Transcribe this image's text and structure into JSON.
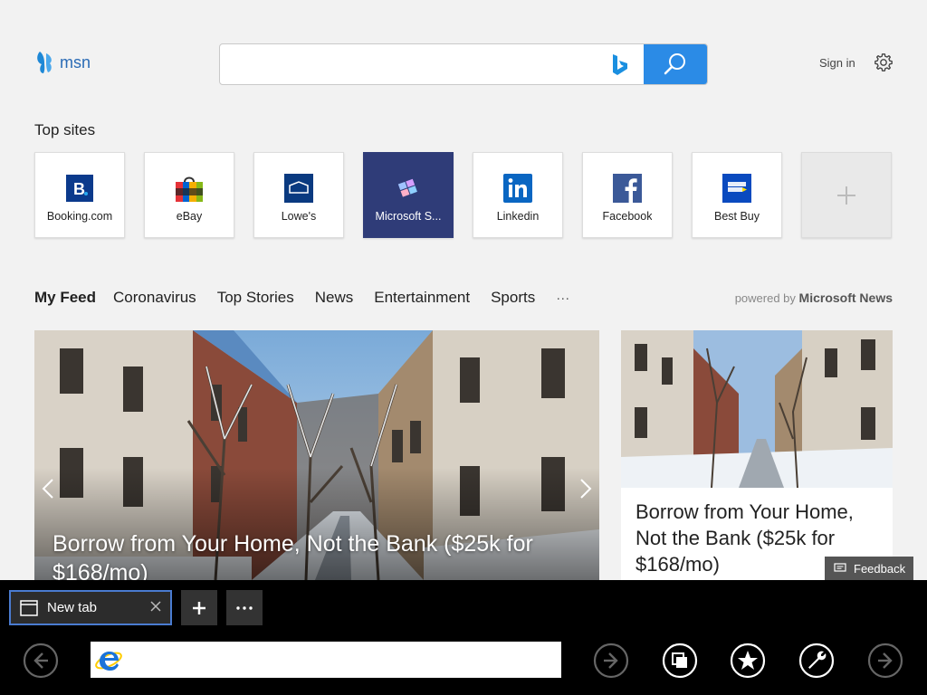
{
  "header": {
    "logo_text": "msn",
    "search_placeholder": "",
    "signin_label": "Sign in"
  },
  "top_sites": {
    "title": "Top sites",
    "tiles": [
      {
        "label": "Booking.com",
        "icon": "booking-icon"
      },
      {
        "label": "eBay",
        "icon": "ebay-icon"
      },
      {
        "label": "Lowe's",
        "icon": "lowes-icon"
      },
      {
        "label": "Microsoft S...",
        "icon": "microsoft-store-icon"
      },
      {
        "label": "Linkedin",
        "icon": "linkedin-icon"
      },
      {
        "label": "Facebook",
        "icon": "facebook-icon"
      },
      {
        "label": "Best Buy",
        "icon": "bestbuy-icon"
      }
    ],
    "add_icon": "plus-icon"
  },
  "feed_nav": {
    "items": [
      "My Feed",
      "Coronavirus",
      "Top Stories",
      "News",
      "Entertainment",
      "Sports"
    ],
    "more": "···",
    "powered_prefix": "powered by",
    "powered_brand": "Microsoft News"
  },
  "cards": {
    "hero_title": "Borrow from Your Home, Not the Bank ($25k for $168/mo)",
    "side_title": "Borrow from Your Home, Not the Bank ($25k for $168/mo)"
  },
  "feedback_label": "Feedback",
  "browser": {
    "tab_label": "New tab",
    "address_value": "",
    "colors": {
      "accent": "#2b8be6",
      "tab_border": "#4a7bd0"
    }
  }
}
